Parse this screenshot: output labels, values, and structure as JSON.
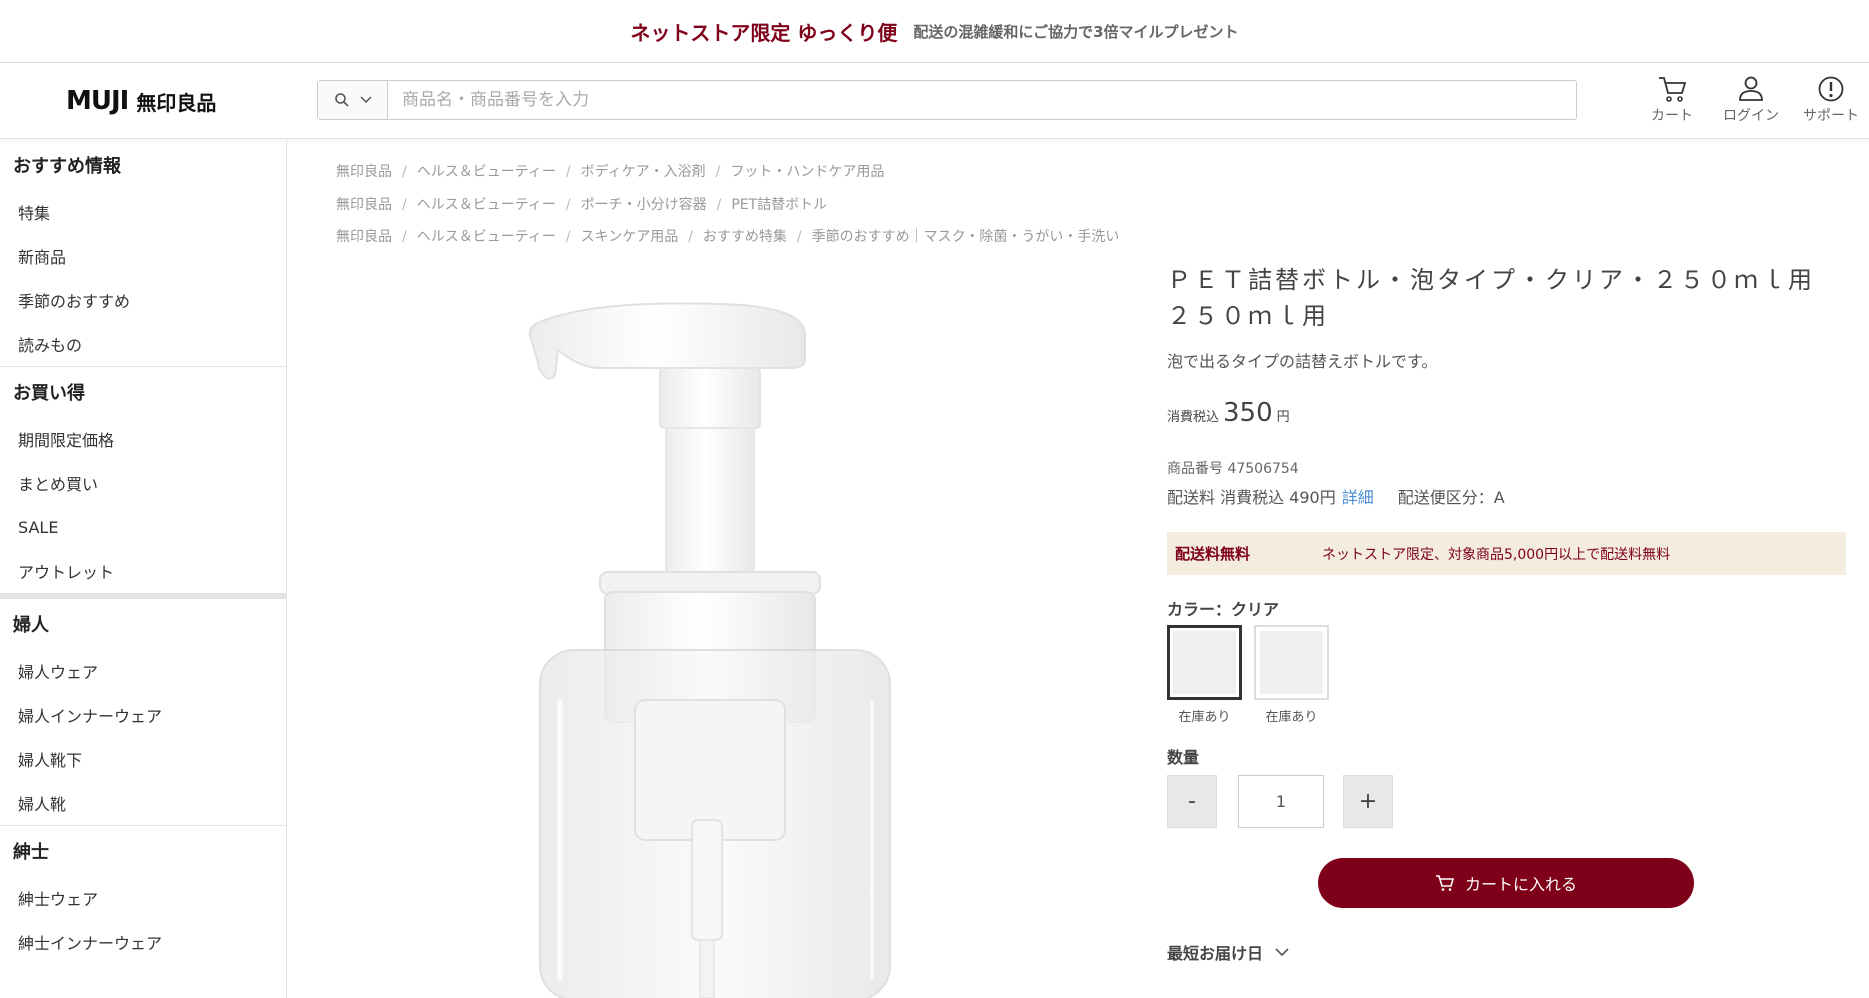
{
  "banner": {
    "main": "ネットストア限定 ゆっくり便",
    "sub": "配送の混雑緩和にご協力で3倍マイルプレゼント"
  },
  "header": {
    "logo_en": "MUJI",
    "logo_ja": "無印良品",
    "search_placeholder": "商品名・商品番号を入力",
    "icons": {
      "cart": "カート",
      "login": "ログイン",
      "support": "サポート"
    }
  },
  "sidebar": {
    "sections": [
      {
        "title": "おすすめ情報",
        "items": [
          "特集",
          "新商品",
          "季節のおすすめ",
          "読みもの"
        ]
      },
      {
        "title": "お買い得",
        "items": [
          "期間限定価格",
          "まとめ買い",
          "SALE",
          "アウトレット"
        ]
      },
      {
        "title": "婦人",
        "items": [
          "婦人ウェア",
          "婦人インナーウェア",
          "婦人靴下",
          "婦人靴"
        ]
      },
      {
        "title": "紳士",
        "items": [
          "紳士ウェア",
          "紳士インナーウェア"
        ]
      }
    ]
  },
  "breadcrumbs": [
    [
      "無印良品",
      "ヘルス＆ビューティー",
      "ボディケア・入浴剤",
      "フット・ハンドケア用品"
    ],
    [
      "無印良品",
      "ヘルス＆ビューティー",
      "ポーチ・小分け容器",
      "PET詰替ボトル"
    ],
    [
      "無印良品",
      "ヘルス＆ビューティー",
      "スキンケア用品",
      "おすすめ特集",
      "季節のおすすめ｜マスク・除菌・うがい・手洗い"
    ]
  ],
  "product": {
    "title": "ＰＥＴ詰替ボトル・泡タイプ・クリア・２５０ｍｌ用 ２５０ｍｌ用",
    "description": "泡で出るタイプの詰替えボトルです。",
    "price_label": "消費税込",
    "price": "350",
    "price_unit": "円",
    "sku": "商品番号 47506754",
    "shipping": "配送料 消費税込 490円",
    "shipping_link": "詳細",
    "shipping_class": "配送便区分：A",
    "free_shipping_title": "配送料無料",
    "free_shipping_text": "ネットストア限定、対象商品5,000円以上で配送料無料",
    "color_label": "カラー：クリア",
    "swatches": [
      {
        "stock": "在庫あり",
        "selected": true
      },
      {
        "stock": "在庫あり",
        "selected": false
      }
    ],
    "quantity_label": "数量",
    "quantity": "1",
    "minus": "-",
    "plus": "+",
    "add_to_cart": "カートに入れる",
    "delivery_label": "最短お届け日"
  },
  "colors": {
    "brand": "#7f0019",
    "free_shipping_bg": "#f3ecdf",
    "link": "#4a8ed6"
  }
}
